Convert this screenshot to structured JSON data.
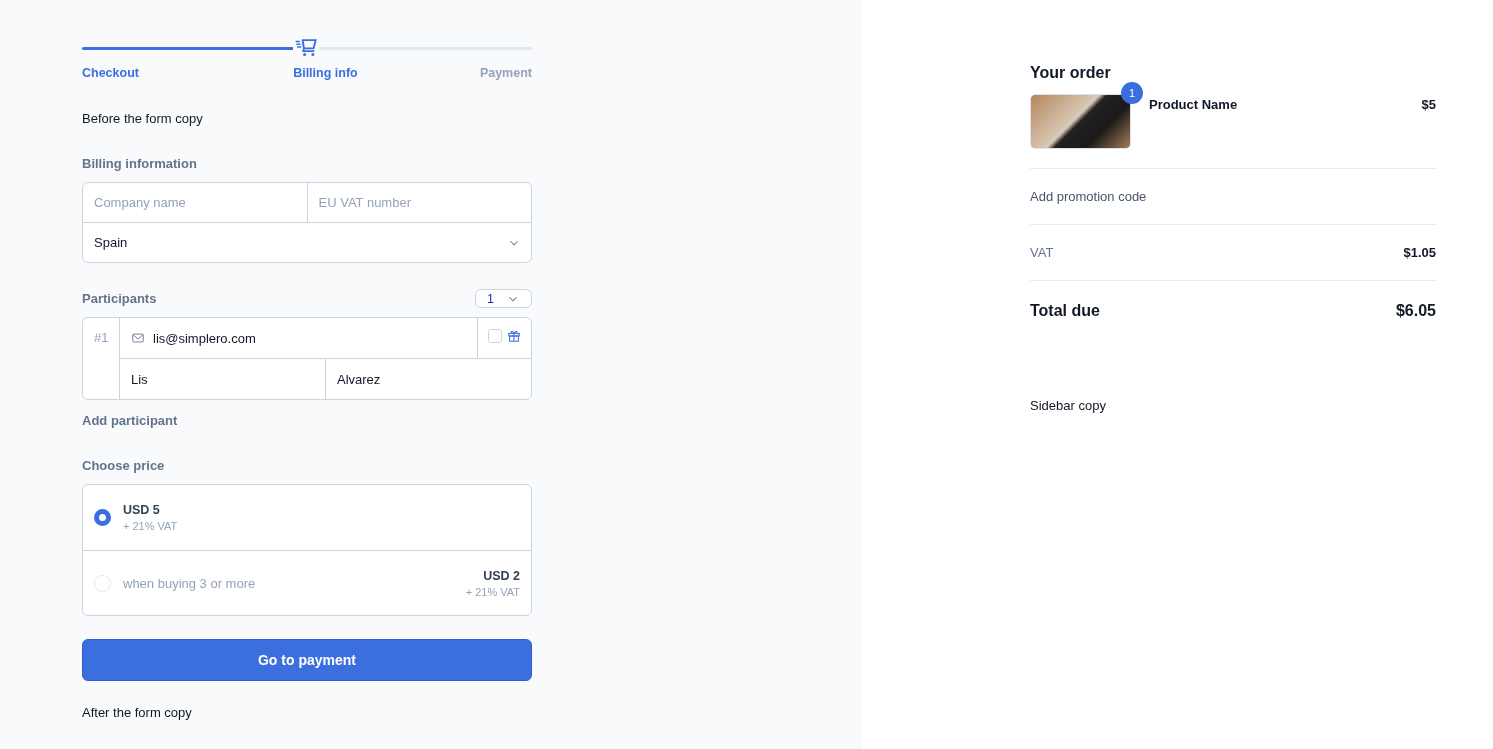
{
  "progress": {
    "level": 0.47,
    "steps": [
      {
        "label": "Checkout",
        "active": true
      },
      {
        "label": "Billing info",
        "active": true
      },
      {
        "label": "Payment",
        "active": false
      }
    ]
  },
  "before_copy": "Before the form copy",
  "billing": {
    "heading": "Billing information",
    "company": {
      "placeholder": "Company name"
    },
    "vat": {
      "placeholder": "EU VAT number"
    },
    "country": {
      "value": "Spain"
    }
  },
  "participants": {
    "heading": "Participants",
    "count": "1",
    "rows": [
      {
        "number": "#1",
        "email": "lis@simplero.com",
        "gift": false,
        "first_name": "Lis",
        "last_name": "Alvarez"
      }
    ],
    "add_link": "Add participant"
  },
  "price": {
    "heading": "Choose price",
    "options": [
      {
        "selected": true,
        "title": "USD 5",
        "vat": "+ 21% VAT"
      },
      {
        "selected": false,
        "condition": "when buying 3 or more",
        "title": "USD 2",
        "vat": "+ 21% VAT"
      }
    ]
  },
  "submit": "Go to payment",
  "after_copy": "After the form copy",
  "order": {
    "heading": "Your order",
    "items": [
      {
        "quantity": "1",
        "name": "Product Name",
        "price": "$5"
      }
    ],
    "promo": "Add promotion code",
    "vat": {
      "label": "VAT",
      "value": "$1.05"
    },
    "total": {
      "label": "Total due",
      "value": "$6.05"
    },
    "sidebar_copy": "Sidebar copy"
  }
}
